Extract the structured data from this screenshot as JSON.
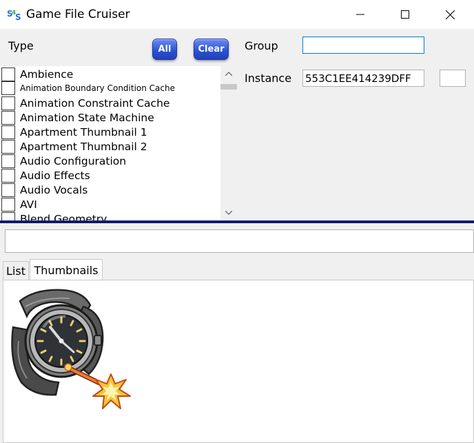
{
  "window": {
    "title": "Game File Cruiser",
    "icon": "s4s-logo-icon",
    "controls": [
      "minimize-icon",
      "maximize-icon",
      "close-icon"
    ]
  },
  "type_panel": {
    "label": "Type",
    "all_button": "All",
    "clear_button": "Clear",
    "items": [
      {
        "label": "Ambience",
        "checked": false
      },
      {
        "label": "Animation Boundary Condition Cache",
        "checked": false
      },
      {
        "label": "Animation Constraint Cache",
        "checked": false
      },
      {
        "label": "Animation State Machine",
        "checked": false
      },
      {
        "label": "Apartment Thumbnail 1",
        "checked": false
      },
      {
        "label": "Apartment Thumbnail 2",
        "checked": false
      },
      {
        "label": "Audio Configuration",
        "checked": false
      },
      {
        "label": "Audio Effects",
        "checked": false
      },
      {
        "label": "Audio Vocals",
        "checked": false
      },
      {
        "label": "AVI",
        "checked": false
      },
      {
        "label": "Blend Geometry",
        "checked": false
      }
    ]
  },
  "group": {
    "label": "Group",
    "value": ""
  },
  "instance": {
    "label": "Instance",
    "value": "553C1EE414239DFF",
    "extra_value": ""
  },
  "filter": {
    "value": ""
  },
  "tabs": [
    {
      "label": "List",
      "active": false
    },
    {
      "label": "Thumbnails",
      "active": true
    }
  ],
  "thumbnail": {
    "icon": "wristwatch-teleport-icon"
  },
  "colors": {
    "splitter": "#0d1a6e",
    "button_blue": "#2a4fd0",
    "focus_border": "#0078d7"
  }
}
